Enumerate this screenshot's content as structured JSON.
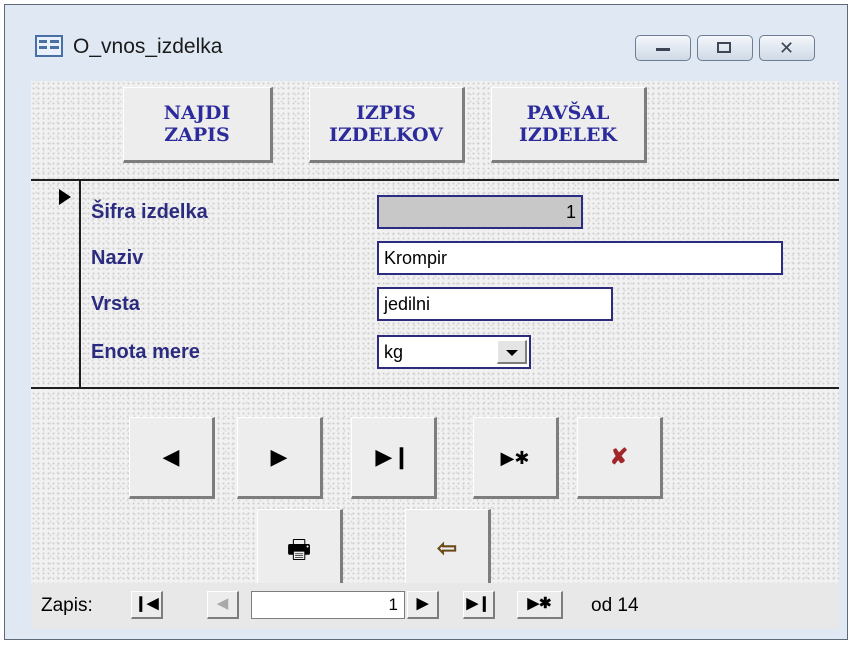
{
  "window": {
    "title": "O_vnos_izdelka"
  },
  "header_buttons": [
    {
      "line1": "NAJDI",
      "line2": "ZAPIS"
    },
    {
      "line1": "IZPIS",
      "line2": "IZDELKOV"
    },
    {
      "line1": "PAVŠAL",
      "line2": "IZDELEK"
    }
  ],
  "fields": {
    "sifra": {
      "label": "Šifra izdelka",
      "value": "1"
    },
    "naziv": {
      "label": "Naziv",
      "value": "Krompir"
    },
    "vrsta": {
      "label": "Vrsta",
      "value": "jedilni"
    },
    "enota": {
      "label": "Enota mere",
      "value": "kg"
    }
  },
  "nav_buttons": {
    "prev": "◀",
    "next": "▶",
    "last": "▶❙",
    "new": "▶✱",
    "delete": "✘",
    "print": "🖶",
    "exit": "⇦"
  },
  "statusbar": {
    "label": "Zapis:",
    "first": "❙◀",
    "prev": "◀",
    "current": "1",
    "next": "▶",
    "last": "▶❙",
    "new": "▶✱",
    "total": "od  14"
  },
  "colors": {
    "label": "#2b2b7f",
    "delete_icon": "#a0262a"
  }
}
